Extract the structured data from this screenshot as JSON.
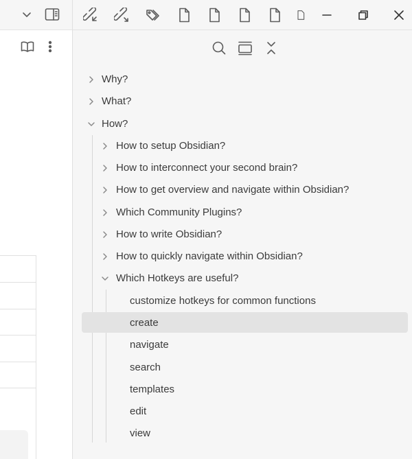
{
  "left_pane": {
    "toolbar": {
      "dropdown_icon": "chevron-down-icon",
      "sidebar_toggle_icon": "sidebar-toggle-icon"
    },
    "header": {
      "reading_mode_icon": "book-icon",
      "more_options_icon": "more-vertical-icon"
    }
  },
  "top_bar": {
    "icons": [
      "link-incoming-icon",
      "link-outgoing-icon",
      "tags-icon",
      "file-icon",
      "file-icon",
      "file-icon",
      "file-icon",
      "file-icon"
    ],
    "window_controls": [
      "minimize-icon",
      "restore-icon",
      "close-icon"
    ]
  },
  "outline_toolbar": {
    "icons": [
      "search-icon",
      "collapse-panel-icon",
      "collapse-all-icon"
    ]
  },
  "outline": {
    "top_items": [
      {
        "label": "Why?",
        "expanded": false
      },
      {
        "label": "What?",
        "expanded": false
      },
      {
        "label": "How?",
        "expanded": true
      }
    ],
    "how_children": [
      {
        "label": "How to setup Obsidian?",
        "expanded": false
      },
      {
        "label": "How to interconnect your second brain?",
        "expanded": false
      },
      {
        "label": "How to get overview and navigate within Obsidian?",
        "expanded": false
      },
      {
        "label": "Which Community Plugins?",
        "expanded": false
      },
      {
        "label": "How to write Obsidian?",
        "expanded": false
      },
      {
        "label": "How to quickly navigate within Obsidian?",
        "expanded": false
      },
      {
        "label": "Which Hotkeys are useful?",
        "expanded": true
      }
    ],
    "hotkey_children": [
      {
        "label": "customize hotkeys for common functions"
      },
      {
        "label": "create",
        "active": true
      },
      {
        "label": "navigate"
      },
      {
        "label": "search"
      },
      {
        "label": "templates"
      },
      {
        "label": "edit"
      },
      {
        "label": "view"
      }
    ]
  }
}
